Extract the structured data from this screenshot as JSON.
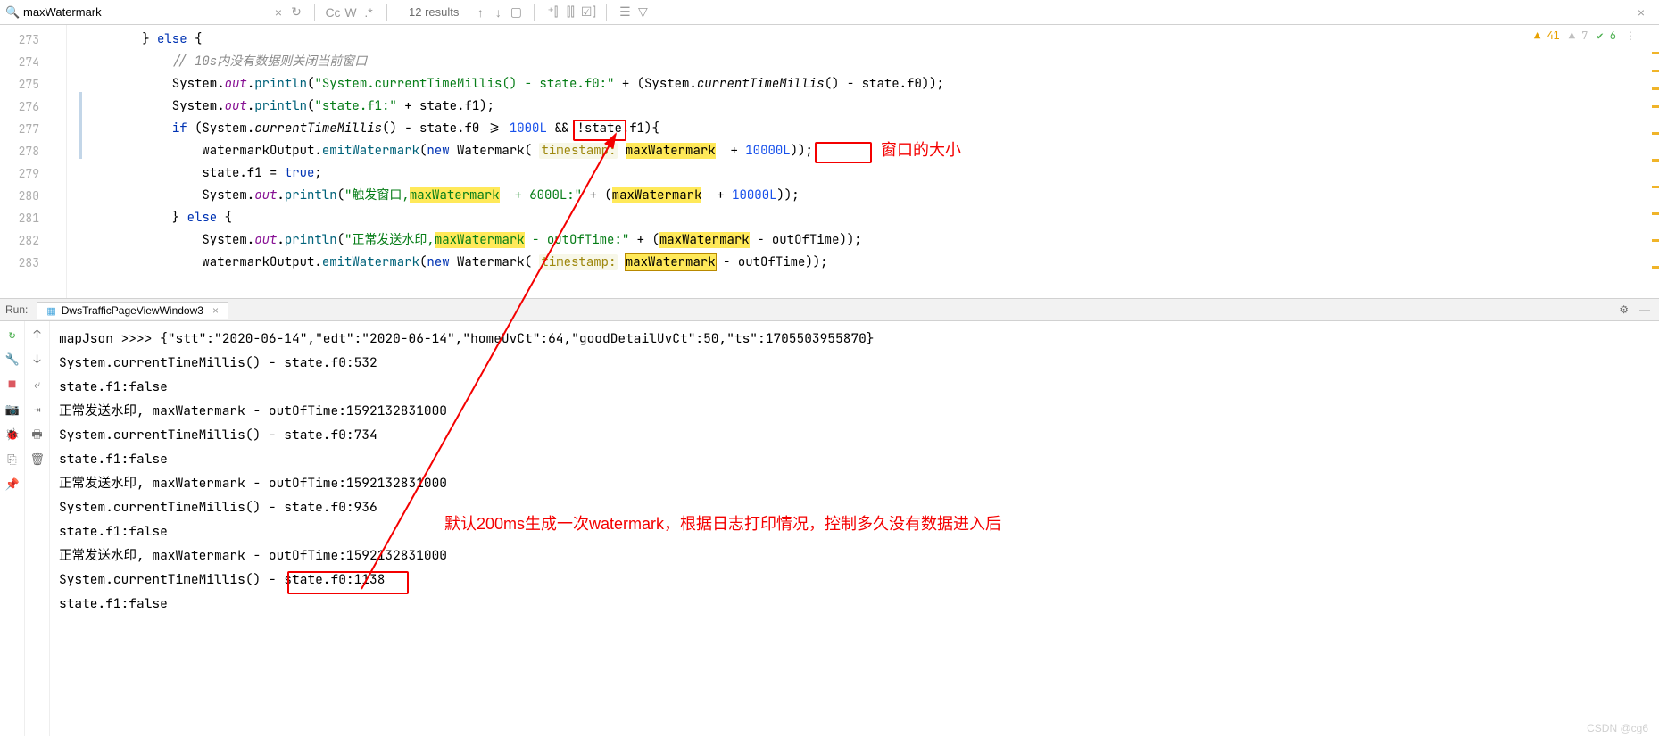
{
  "find": {
    "query": "maxWatermark",
    "results_text": "12 results"
  },
  "status": {
    "warnings_strong": "41",
    "warnings_weak": "7",
    "ok": "6"
  },
  "gutter": [
    "273",
    "274",
    "275",
    "276",
    "277",
    "278",
    "279",
    "280",
    "281",
    "282",
    "283"
  ],
  "code": {
    "l273": {
      "a": "        } ",
      "kw": "else",
      "b": " {"
    },
    "l274": {
      "com": "            // 10s内没有数据则关闭当前窗口"
    },
    "l275": {
      "a": "            System.",
      "out": "out",
      "b": ".",
      "m": "println",
      "c": "(",
      "s": "\"System.currentTimeMillis() - state.f0:\"",
      "d": " + (System.",
      "m2": "currentTimeMillis",
      "e": "() - state.f0));"
    },
    "l276": {
      "a": "            System.",
      "out": "out",
      "b": ".",
      "m": "println",
      "c": "(",
      "s": "\"state.f1:\"",
      "d": " + state.f1);"
    },
    "l277": {
      "a": "            ",
      "kw": "if",
      "b": " (System.",
      "m": "currentTimeMillis",
      "c": "() - state.f0 >= ",
      "n": "1000L",
      "d": " && !state.f1){"
    },
    "l278": {
      "a": "                watermarkOutput.",
      "m": "emitWatermark",
      "b": "(",
      "kw": "new",
      "c": " Watermark( ",
      "p": "timestamp:",
      "d": " ",
      "hl": "maxWatermark",
      "e": "  + ",
      "n": "10000L",
      "f": "));"
    },
    "l279": {
      "a": "                state.f1 = ",
      "kw": "true",
      "b": ";"
    },
    "l280": {
      "a": "                System.",
      "out": "out",
      "b": ".",
      "m": "println",
      "c": "(",
      "s1": "\"触发窗口,",
      "hl1": "maxWatermark",
      "s2": "  + 6000L:\"",
      "d": " + (",
      "hl2": "maxWatermark",
      "e": "  + ",
      "n": "10000L",
      "f": "));"
    },
    "l281": {
      "a": "            } ",
      "kw": "else",
      "b": " {"
    },
    "l282": {
      "a": "                System.",
      "out": "out",
      "b": ".",
      "m": "println",
      "c": "(",
      "s1": "\"正常发送水印,",
      "hl1": "maxWatermark",
      "s2": " - outOfTime:\"",
      "d": " + (",
      "hl2": "maxWatermark",
      "e": " - outOfTime));"
    },
    "l283": {
      "a": "                watermarkOutput.",
      "m": "emitWatermark",
      "b": "(",
      "kw": "new",
      "c": " Watermark( ",
      "p": "timestamp:",
      "d": " ",
      "hl": "maxWatermark",
      "e": " - outOfTime));"
    }
  },
  "annot": {
    "label1": "窗口的大小",
    "label2": "默认200ms生成一次watermark，根据日志打印情况，控制多久没有数据进入后"
  },
  "run": {
    "label": "Run:",
    "tab": "DwsTrafficPageViewWindow3"
  },
  "console": [
    "mapJson >>>> {\"stt\":\"2020-06-14\",\"edt\":\"2020-06-14\",\"homeUvCt\":64,\"goodDetailUvCt\":50,\"ts\":1705503955870}",
    "System.currentTimeMillis() - state.f0:532",
    "state.f1:false",
    "正常发送水印, maxWatermark - outOfTime:1592132831000",
    "System.currentTimeMillis() - state.f0:734",
    "state.f1:false",
    "正常发送水印, maxWatermark - outOfTime:1592132831000",
    "System.currentTimeMillis() - state.f0:936",
    "state.f1:false",
    "正常发送水印, maxWatermark - outOfTime:1592132831000",
    "System.currentTimeMillis() - state.f0:1138",
    "state.f1:false"
  ],
  "watermark_text": "CSDN @cg6"
}
